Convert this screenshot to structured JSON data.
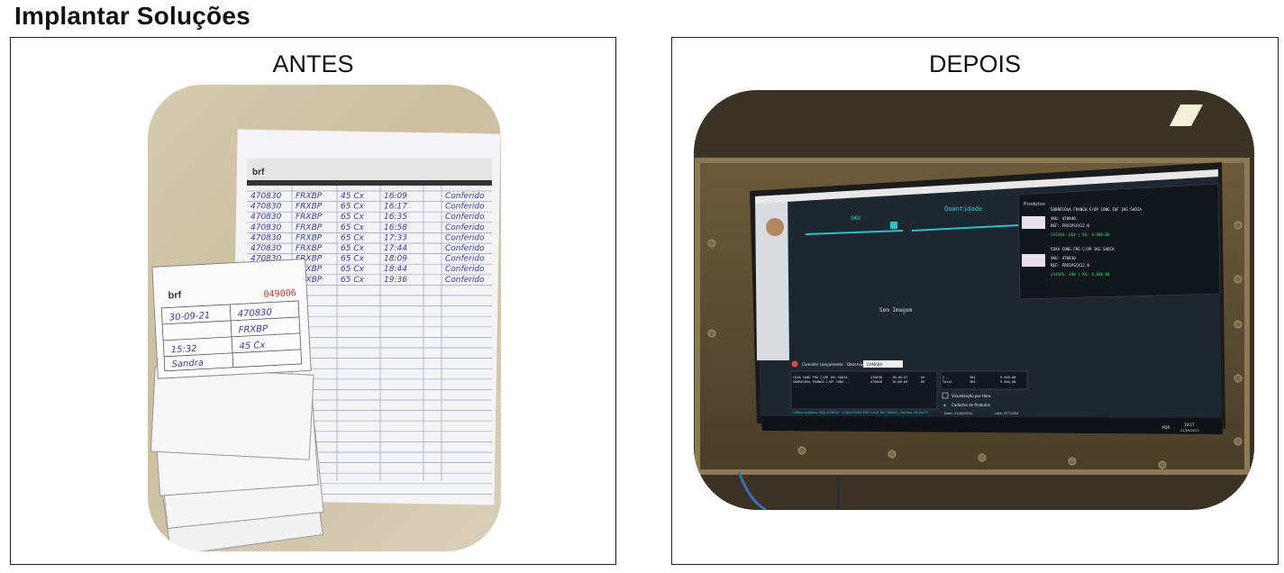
{
  "title": "Implantar Soluções",
  "panels": {
    "before": {
      "label": "ANTES"
    },
    "after": {
      "label": "DEPOIS"
    }
  },
  "antes_photo": {
    "sheet_brand": "brf",
    "tag_brand": "brf",
    "tag_number": "049006",
    "handwritten_rows": [
      [
        "470830",
        "FRXBP",
        "45 Cx",
        "16:09",
        "Conferido"
      ],
      [
        "470830",
        "FRXBP",
        "65 Cx",
        "16:17",
        "Conferido"
      ],
      [
        "470830",
        "FRXBP",
        "65 Cx",
        "16:35",
        "Conferido"
      ],
      [
        "470830",
        "FRXBP",
        "65 Cx",
        "16:58",
        "Conferido"
      ],
      [
        "470830",
        "FRXBP",
        "65 Cx",
        "17:33",
        "Conferido"
      ],
      [
        "470830",
        "FRXBP",
        "65 Cx",
        "17:44",
        "Conferido"
      ],
      [
        "470830",
        "FRXBP",
        "65 Cx",
        "18:09",
        "Conferido"
      ],
      [
        "470830",
        "FRXBP",
        "65 Cx",
        "18:44",
        "Conferido"
      ],
      [
        "470830",
        "FRXBP",
        "65 Cx",
        "19:36",
        "Conferido"
      ]
    ],
    "tag_fields": [
      "30-09-21",
      "470830",
      "FRXBP",
      "45 Cx",
      "15:32",
      "Sandra"
    ]
  },
  "depois_photo": {
    "screen_header_qty": "Quantidade",
    "screen_sku_label": "SKU",
    "screen_no_image": "Sem Imagem",
    "screen_products_title": "Produtos",
    "product1_name": "SOBRECOXA FRANGO C/OP CONG IQF 1KG SADIA",
    "product1_sku": "SKU: 470840",
    "product1_ref": "REF: FRSIPSCX12.0",
    "product1_stats": "CAIXAS: 664 | KG: 4.980,00",
    "product2_name": "COXA CONG FRG C/OP 1KG SADIA",
    "product2_sku": "SKU: 470830",
    "product2_ref": "REF: FRSIPSCX12.0",
    "product2_stats": "CAIXAS: 390 | KG: 4.680,00",
    "cancel_label": "Cancelar Lançamento",
    "obs_label": "Observação",
    "obs_value": "CAMARA",
    "check_label": "Visualização por Hora",
    "add_label": "Cadastro de Produtos",
    "total_label": "Total",
    "date_label": "Data: 21/09/2021",
    "lote_label": "Lote: 3771264",
    "status_bar": "Ultimo registro: SKU 470830 - COXA CONG FRG C/OP 1KG SADIA - Horário 16:46:57",
    "clock_time": "10:17",
    "clock_date": "21/09/2021",
    "lang": "POR",
    "list_rows": [
      [
        "COXA CONG FRG C/OP 1KG SADIA",
        "470830",
        "16:46:57",
        "65"
      ],
      [
        "SOBRECOXA FRANGO C/OP CONG...",
        "470840",
        "16:06:09",
        "65"
      ]
    ],
    "summary_rows": [
      [
        "2",
        "384",
        "9.640,00"
      ],
      [
        "Total",
        "384",
        "9.640,00"
      ]
    ]
  }
}
